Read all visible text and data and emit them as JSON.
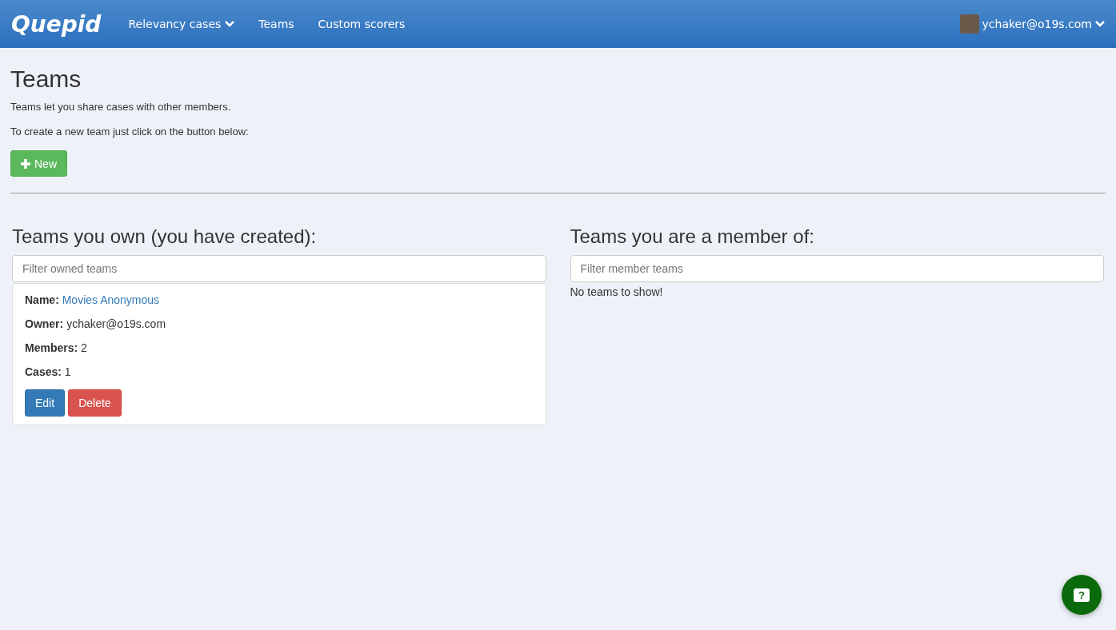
{
  "navbar": {
    "brand": "Quepid",
    "items": [
      {
        "label": "Relevancy cases",
        "dropdown": true
      },
      {
        "label": "Teams",
        "dropdown": false
      },
      {
        "label": "Custom scorers",
        "dropdown": false
      }
    ],
    "user": "ychaker@o19s.com"
  },
  "page": {
    "title": "Teams",
    "intro": "Teams let you share cases with other members.",
    "instruction": "To create a new team just click on the button below:",
    "new_button": "New"
  },
  "owned": {
    "heading": "Teams you own (you have created):",
    "placeholder": "Filter owned teams",
    "teams": [
      {
        "fields": [
          {
            "label": "Name:",
            "value": "Movies Anonymous",
            "kind": "link"
          },
          {
            "label": "Owner:",
            "value": "ychaker@o19s.com",
            "kind": "text"
          },
          {
            "label": "Members:",
            "value": "2",
            "kind": "text"
          },
          {
            "label": "Cases:",
            "value": "1",
            "kind": "text"
          }
        ],
        "buttons": [
          {
            "label": "Edit",
            "kind": "primary"
          },
          {
            "label": "Delete",
            "kind": "danger"
          }
        ]
      }
    ]
  },
  "member": {
    "heading": "Teams you are a member of:",
    "placeholder": "Filter member teams",
    "empty": "No teams to show!"
  },
  "help_button": {
    "glyph": "?"
  }
}
